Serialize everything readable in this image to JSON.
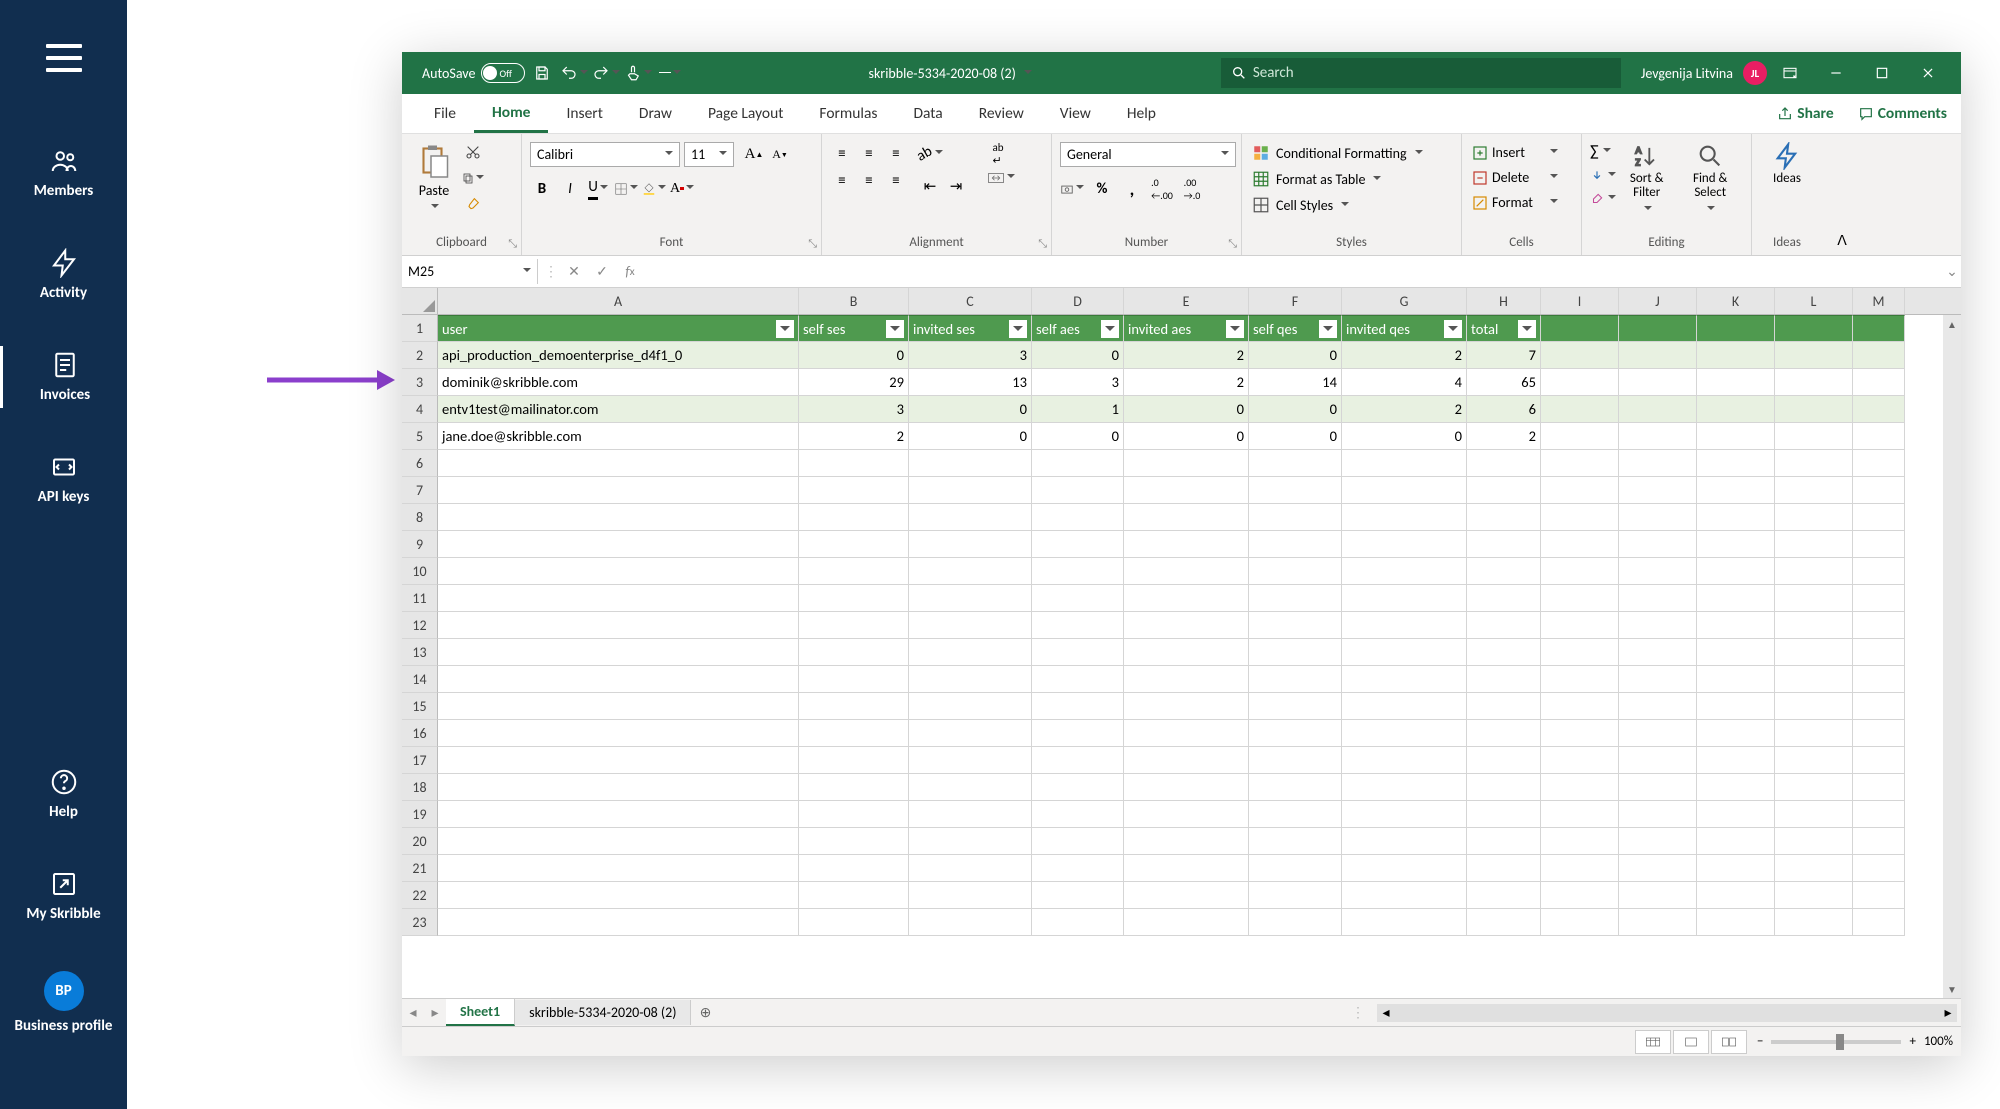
{
  "sidebar": {
    "items": [
      {
        "label": "Members"
      },
      {
        "label": "Activity"
      },
      {
        "label": "Invoices"
      },
      {
        "label": "API keys"
      }
    ],
    "help": "Help",
    "my_skribble": "My Skribble",
    "bp_initials": "BP",
    "bp_label": "Business\nprofile"
  },
  "titlebar": {
    "autosave": "AutoSave",
    "autosave_state": "Off",
    "filename": "skribble-5334-2020-08 (2)",
    "search_placeholder": "Search",
    "user_name": "Jevgenija Litvina",
    "user_initials": "JL"
  },
  "tabs": [
    "File",
    "Home",
    "Insert",
    "Draw",
    "Page Layout",
    "Formulas",
    "Data",
    "Review",
    "View",
    "Help"
  ],
  "share": "Share",
  "comments": "Comments",
  "ribbon": {
    "clipboard": {
      "paste": "Paste",
      "label": "Clipboard"
    },
    "font": {
      "name": "Calibri",
      "size": "11",
      "label": "Font"
    },
    "alignment": {
      "label": "Alignment"
    },
    "number": {
      "format": "General",
      "label": "Number"
    },
    "styles": {
      "cond": "Conditional Formatting",
      "table": "Format as Table",
      "cell": "Cell Styles",
      "label": "Styles"
    },
    "cells": {
      "insert": "Insert",
      "delete": "Delete",
      "format": "Format",
      "label": "Cells"
    },
    "editing": {
      "sort": "Sort &\nFilter",
      "find": "Find &\nSelect",
      "label": "Editing"
    },
    "ideas": {
      "ideas": "Ideas",
      "label": "Ideas"
    }
  },
  "namebox": "M25",
  "columns": [
    "A",
    "B",
    "C",
    "D",
    "E",
    "F",
    "G",
    "H",
    "I",
    "J",
    "K",
    "L",
    "M"
  ],
  "table": {
    "headers": [
      "user",
      "self ses",
      "invited ses",
      "self aes",
      "invited aes",
      "self qes",
      "invited qes",
      "total"
    ],
    "rows": [
      {
        "user": "api_production_demoenterprise_d4f1_0",
        "self_ses": "0",
        "invited_ses": "3",
        "self_aes": "0",
        "invited_aes": "2",
        "self_qes": "0",
        "invited_qes": "2",
        "total": "7"
      },
      {
        "user": "dominik@skribble.com",
        "self_ses": "29",
        "invited_ses": "13",
        "self_aes": "3",
        "invited_aes": "2",
        "self_qes": "14",
        "invited_qes": "4",
        "total": "65"
      },
      {
        "user": "entv1test@mailinator.com",
        "self_ses": "3",
        "invited_ses": "0",
        "self_aes": "1",
        "invited_aes": "0",
        "self_qes": "0",
        "invited_qes": "2",
        "total": "6"
      },
      {
        "user": "jane.doe@skribble.com",
        "self_ses": "2",
        "invited_ses": "0",
        "self_aes": "0",
        "invited_aes": "0",
        "self_qes": "0",
        "invited_qes": "0",
        "total": "2"
      }
    ]
  },
  "sheettabs": [
    "Sheet1",
    "skribble-5334-2020-08 (2)"
  ],
  "zoom": "100%"
}
